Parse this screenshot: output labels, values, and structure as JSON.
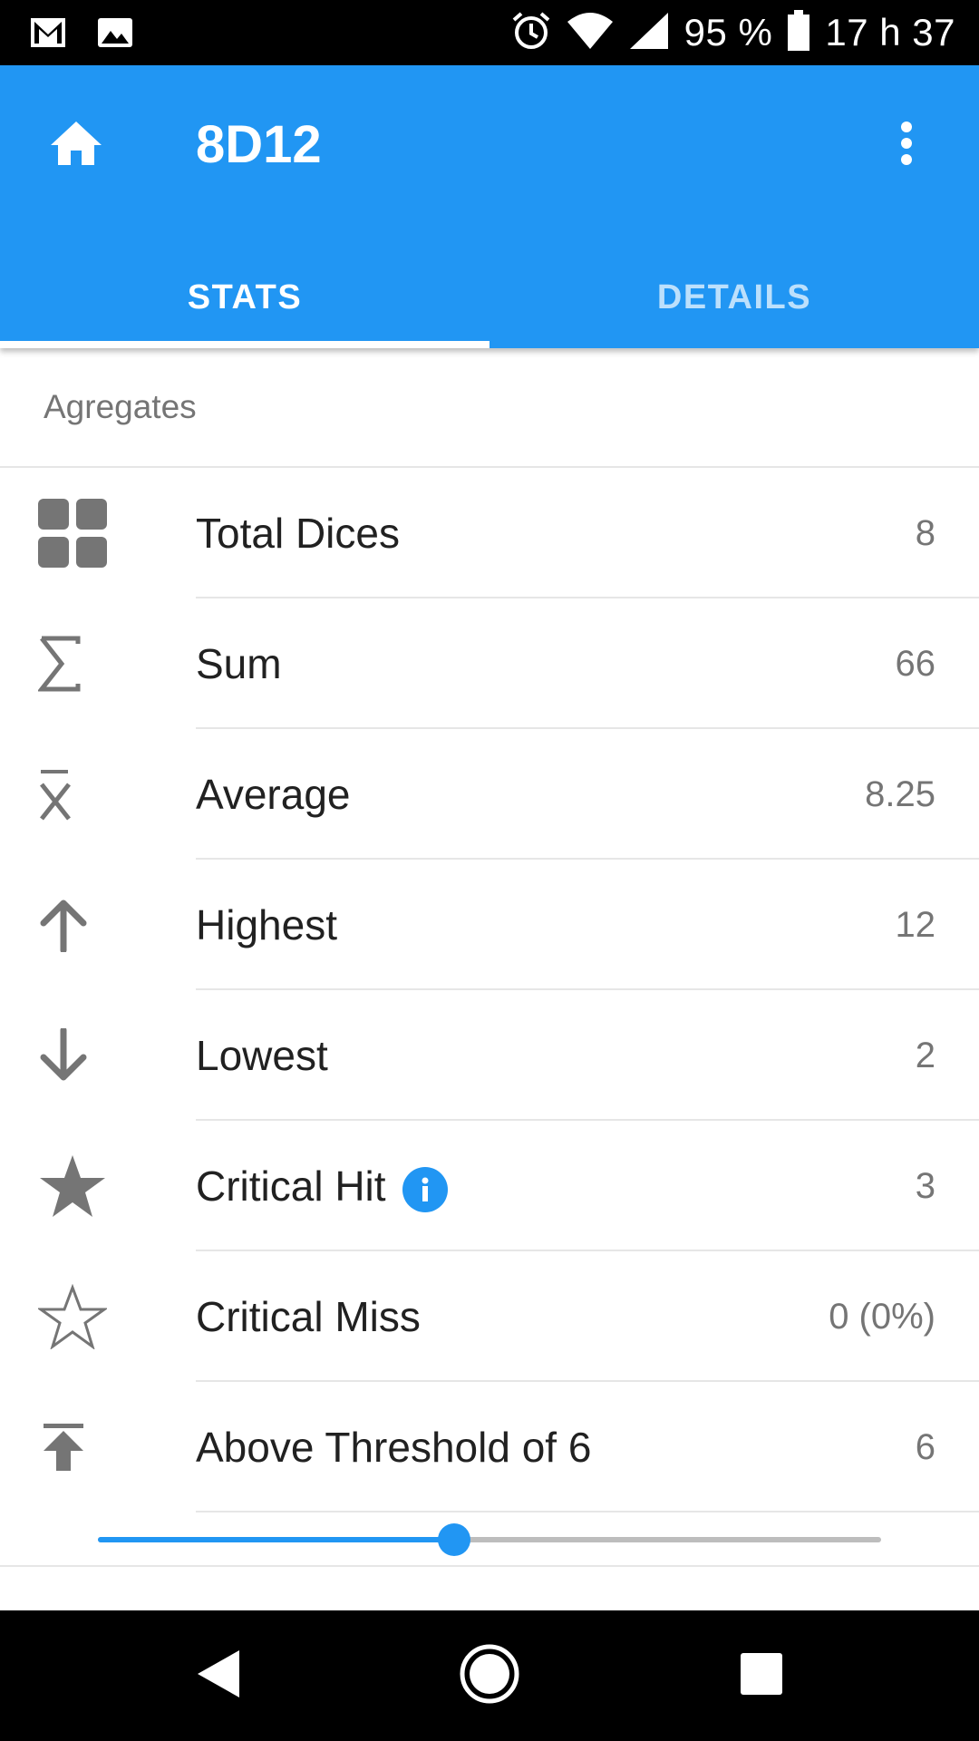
{
  "status_bar": {
    "battery": "95 %",
    "time": "17 h 37"
  },
  "app_bar": {
    "title": "8D12",
    "tabs": [
      {
        "label": "STATS",
        "active": true
      },
      {
        "label": "DETAILS",
        "active": false
      }
    ]
  },
  "section": {
    "title": "Agregates"
  },
  "stats": [
    {
      "icon": "grid-icon",
      "label": "Total Dices",
      "value": "8"
    },
    {
      "icon": "sigma-icon",
      "label": "Sum",
      "value": "66"
    },
    {
      "icon": "mean-x-bar-icon",
      "label": "Average",
      "value": "8.25"
    },
    {
      "icon": "arrow-up-icon",
      "label": "Highest",
      "value": "12"
    },
    {
      "icon": "arrow-down-icon",
      "label": "Lowest",
      "value": "2"
    },
    {
      "icon": "star-filled-icon",
      "label": "Critical Hit",
      "value": "3"
    },
    {
      "icon": "star-outline-icon",
      "label": "Critical Miss",
      "value": "0 (0%)"
    },
    {
      "icon": "threshold-up-icon",
      "label": "Above Threshold of 6",
      "value": "6"
    }
  ],
  "threshold_slider": {
    "fraction": 0.455
  },
  "colors": {
    "primary": "#2196F3",
    "icon_gray": "#757575",
    "text": "#212121"
  }
}
